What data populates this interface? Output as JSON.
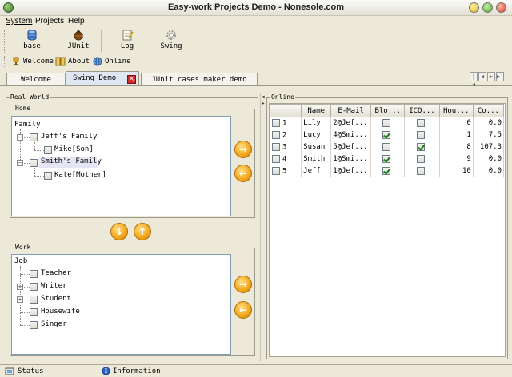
{
  "window": {
    "title": "Easy-work Projects Demo - Nonesole.com"
  },
  "menu": [
    "System",
    "Projects",
    "Help"
  ],
  "toolbar": [
    {
      "label": "base",
      "icon": "database-icon"
    },
    {
      "label": "JUnit",
      "icon": "bug-icon"
    },
    {
      "label": "Log",
      "icon": "notepad-icon"
    },
    {
      "label": "Swing",
      "icon": "gear-icon"
    }
  ],
  "quickbar": [
    {
      "label": "Welcome",
      "icon": "trophy-icon"
    },
    {
      "label": "About",
      "icon": "book-icon"
    },
    {
      "label": "Online",
      "icon": "globe-icon"
    }
  ],
  "tabs": [
    {
      "label": "Welcome"
    },
    {
      "label": "Swing Demo"
    },
    {
      "label": "JUnit cases maker demo"
    }
  ],
  "left": {
    "title": "Real World",
    "home": {
      "title": "Home",
      "root": "Family",
      "items": [
        {
          "label": "Jeff's Family",
          "child": "Mike[Son]"
        },
        {
          "label": "Smith's Family",
          "child": "Kate[Mother]"
        }
      ]
    },
    "work": {
      "title": "Work",
      "root": "Job",
      "items": [
        "Teacher",
        "Writer",
        "Student",
        "Housewife",
        "Singer"
      ]
    }
  },
  "online": {
    "title": "Online",
    "columns": [
      "",
      "Name",
      "E-Mail",
      "Blo...",
      "ICQ...",
      "Hou...",
      "Co..."
    ],
    "rows": [
      {
        "id": "1",
        "name": "Lily",
        "email": "2@Jef...",
        "blog": false,
        "icq": false,
        "hours": "0",
        "cost": "0.0"
      },
      {
        "id": "2",
        "name": "Lucy",
        "email": "4@Smi...",
        "blog": true,
        "icq": false,
        "hours": "1",
        "cost": "7.5"
      },
      {
        "id": "3",
        "name": "Susan",
        "email": "5@Jef...",
        "blog": false,
        "icq": true,
        "hours": "8",
        "cost": "107.3"
      },
      {
        "id": "4",
        "name": "Smith",
        "email": "1@Smi...",
        "blog": true,
        "icq": false,
        "hours": "9",
        "cost": "0.0"
      },
      {
        "id": "5",
        "name": "Jeff",
        "email": "1@Jef...",
        "blog": true,
        "icq": false,
        "hours": "10",
        "cost": "0.0"
      }
    ]
  },
  "status": {
    "left": "Status",
    "right": "Information"
  }
}
